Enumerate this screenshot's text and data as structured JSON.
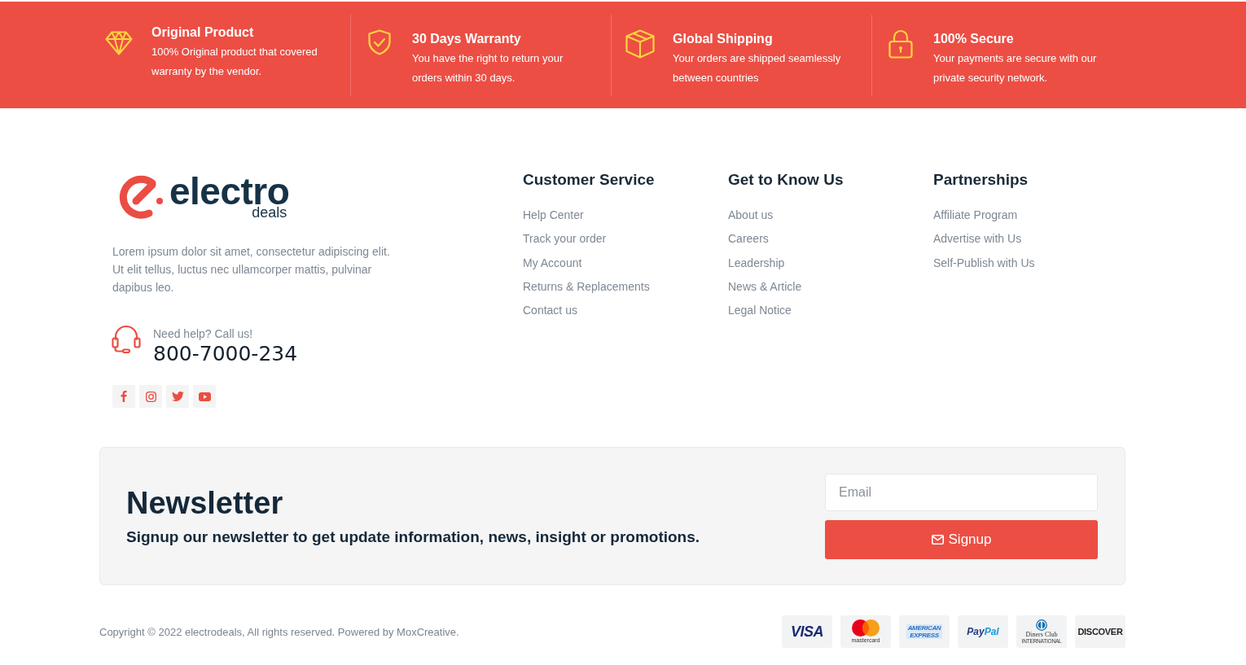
{
  "features": [
    {
      "kind": "product",
      "title": "Original Product",
      "lines": [
        "100% Original product that covered",
        "warranty by the vendor."
      ]
    },
    {
      "kind": "warranty",
      "title": "30 Days Warranty",
      "lines": [
        "You have the right to return your",
        "orders within 30 days."
      ]
    },
    {
      "kind": "shipping",
      "title": "Global Shipping",
      "lines": [
        "Your orders are shipped seamlessly",
        "between countries"
      ]
    },
    {
      "kind": "security",
      "title": "100% Secure",
      "lines": [
        "Your payments are secure with our",
        "private security network."
      ]
    }
  ],
  "brand": {
    "name": "electro",
    "tagline": "deals",
    "description_lines": [
      "Lorem ipsum dolor sit amet, consectetur adipiscing elit.",
      "Ut elit tellus, luctus nec ullamcorper mattis, pulvinar",
      "dapibus leo."
    ]
  },
  "contact": {
    "label": "Need help? Call us!",
    "phone": "800-7000-234"
  },
  "social_links": [
    {
      "kind": "facebook"
    },
    {
      "kind": "instagram"
    },
    {
      "kind": "twitter"
    },
    {
      "kind": "youtube"
    }
  ],
  "link_columns": [
    {
      "title": "Customer Service",
      "links": [
        "Help Center",
        "Track your order",
        "My Account",
        "Returns & Replacements",
        "Contact us"
      ]
    },
    {
      "title": "Get to Know Us",
      "links": [
        "About us",
        "Careers",
        "Leadership",
        "News & Article",
        "Legal Notice"
      ]
    },
    {
      "title": "Partnerships",
      "links": [
        "Affiliate Program",
        "Advertise with Us",
        "Self-Publish with Us"
      ]
    }
  ],
  "newsletter": {
    "title": "Newsletter",
    "text": "Signup our newsletter to get update information, news, insight or promotions.",
    "email": {
      "placeholder": "Email"
    },
    "button": "Signup"
  },
  "copyright": "Copyright © 2022 electrodeals, All rights reserved. Powered by MoxCreative.",
  "payment_methods": [
    {
      "kind": "visa",
      "parts": [
        "VISA"
      ]
    },
    {
      "kind": "mastercard",
      "parts": [
        "mastercard"
      ]
    },
    {
      "kind": "amex",
      "parts": [
        "AMERICAN",
        "EXPRESS"
      ]
    },
    {
      "kind": "paypal",
      "parts": [
        "Pay",
        "Pal"
      ]
    },
    {
      "kind": "diners",
      "parts": [
        "Diners Club",
        "INTERNATIONAL"
      ]
    },
    {
      "kind": "discover",
      "parts": [
        "DISCOVER"
      ]
    }
  ]
}
